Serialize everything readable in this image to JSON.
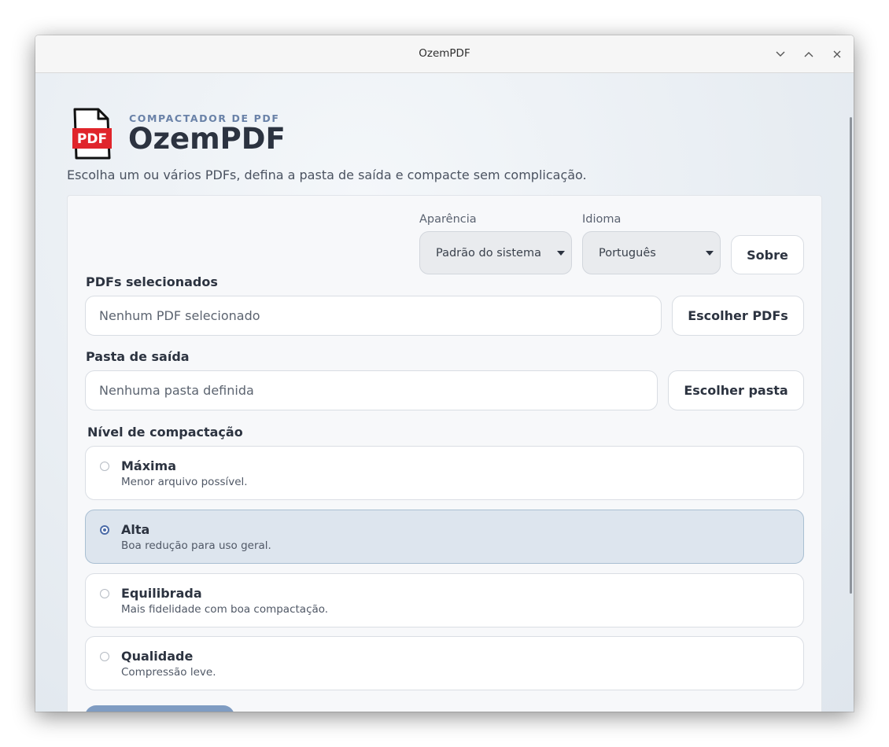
{
  "window": {
    "title": "OzemPDF",
    "controls": [
      "minimize",
      "maximize",
      "close"
    ]
  },
  "header": {
    "kicker": "COMPACTADOR DE PDF",
    "title": "OzemPDF",
    "subtitle": "Escolha um ou vários PDFs, defina a pasta de saída e compacte sem complicação.",
    "logo_text": "PDF"
  },
  "settings": {
    "appearance_label": "Aparência",
    "appearance_value": "Padrão do sistema",
    "language_label": "Idioma",
    "language_value": "Português",
    "about_label": "Sobre"
  },
  "pdfs": {
    "label": "PDFs selecionados",
    "placeholder": "Nenhum PDF selecionado",
    "button": "Escolher PDFs"
  },
  "output": {
    "label": "Pasta de saída",
    "placeholder": "Nenhuma pasta definida",
    "button": "Escolher pasta"
  },
  "compression": {
    "label": "Nível de compactação",
    "selected": "Alta",
    "options": [
      {
        "title": "Máxima",
        "desc": "Menor arquivo possível."
      },
      {
        "title": "Alta",
        "desc": "Boa redução para uso geral."
      },
      {
        "title": "Equilibrada",
        "desc": "Mais fidelidade com boa compactação."
      },
      {
        "title": "Qualidade",
        "desc": "Compressão leve."
      }
    ]
  },
  "colors": {
    "accent": "#4c6ca8",
    "kicker": "#6a82a8",
    "logo_red": "#e0252b",
    "selected_bg": "#dde5ee"
  }
}
